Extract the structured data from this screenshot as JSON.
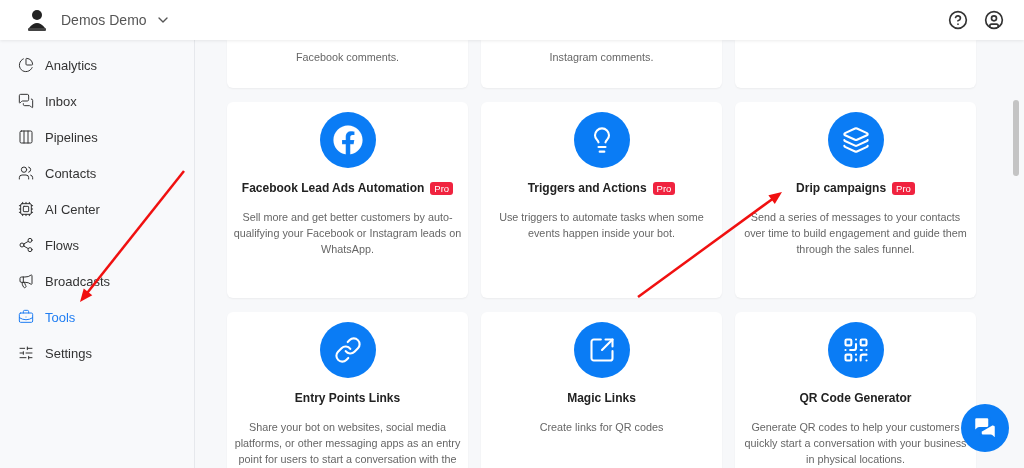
{
  "header": {
    "account": "Demos Demo"
  },
  "sidebar": {
    "items": [
      {
        "label": "Analytics",
        "selected": false
      },
      {
        "label": "Inbox",
        "selected": false
      },
      {
        "label": "Pipelines",
        "selected": false
      },
      {
        "label": "Contacts",
        "selected": false
      },
      {
        "label": "AI Center",
        "selected": false
      },
      {
        "label": "Flows",
        "selected": false
      },
      {
        "label": "Broadcasts",
        "selected": false
      },
      {
        "label": "Tools",
        "selected": true
      },
      {
        "label": "Settings",
        "selected": false
      }
    ]
  },
  "partial_cards": [
    {
      "kind": "text",
      "text": "Facebook comments."
    },
    {
      "kind": "text",
      "text": "Instagram comments."
    },
    {
      "kind": "blank"
    }
  ],
  "tool_cards": [
    {
      "title": "Facebook Lead Ads Automation",
      "pro": true,
      "badge": "Pro",
      "description": "Sell more and get better customers by auto-qualifying your Facebook or Instagram leads on WhatsApp."
    },
    {
      "title": "Triggers and Actions",
      "pro": true,
      "badge": "Pro",
      "description": "Use triggers to automate tasks when some events happen inside your bot."
    },
    {
      "title": "Drip campaigns",
      "pro": true,
      "badge": "Pro",
      "description": "Send a series of messages to your contacts over time to build engagement and guide them through the sales funnel."
    },
    {
      "title": "Entry Points Links",
      "pro": false,
      "description": "Share your bot on websites, social media platforms, or other messaging apps as an entry point for users to start a conversation with the"
    },
    {
      "title": "Magic Links",
      "pro": false,
      "description": "Create links for QR codes"
    },
    {
      "title": "QR Code Generator",
      "pro": false,
      "description": "Generate QR codes to help your customers quickly start a conversation with your business in physical locations."
    }
  ]
}
